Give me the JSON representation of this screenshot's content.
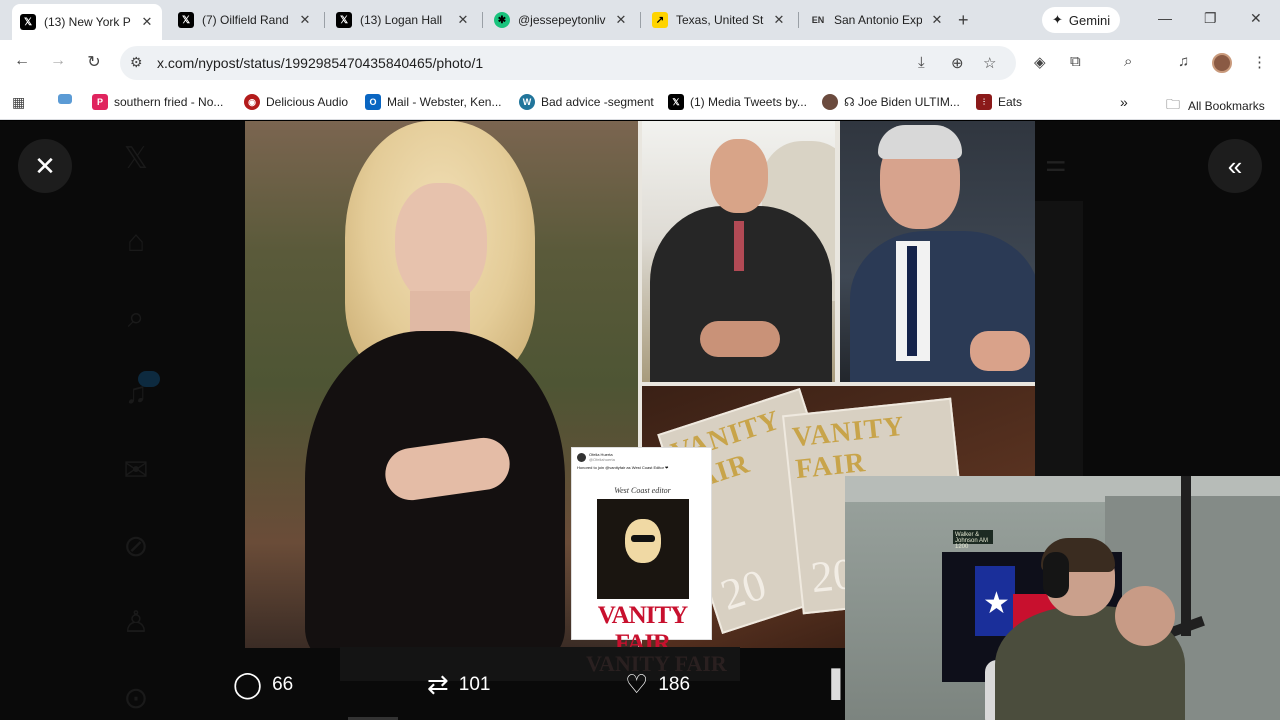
{
  "browser": {
    "tabs": [
      {
        "title": "(13) New York P",
        "favicon": "X",
        "active": true
      },
      {
        "title": "(7) Oilfield Rand",
        "favicon": "X",
        "active": false
      },
      {
        "title": "(13) Logan Hall",
        "favicon": "X",
        "active": false
      },
      {
        "title": "@jessepeytonliv",
        "favicon": "green",
        "active": false
      },
      {
        "title": "Texas, United St",
        "favicon": "yellow",
        "active": false
      },
      {
        "title": "San Antonio Exp",
        "favicon": "EN",
        "active": false
      }
    ],
    "new_tab": "+",
    "gemini_label": "Gemini",
    "url": "x.com/nypost/status/1992985470435840465/photo/1",
    "bookmarks": [
      {
        "label": "southern fried - No...",
        "icon_color": "#e0245e"
      },
      {
        "label": "Delicious Audio",
        "icon_color": "#b31b1b"
      },
      {
        "label": "Mail - Webster, Ken...",
        "icon_color": "#0a66c2"
      },
      {
        "label": "Bad advice -segment",
        "icon_color": "#21759b"
      },
      {
        "label": "(1) Media Tweets by...",
        "icon_color": "#000000"
      },
      {
        "label": "☊ Joe Biden ULTIM...",
        "icon_color": "#6b4b3e"
      },
      {
        "label": "Eats",
        "icon_color": "#8b1a1a"
      }
    ],
    "bookmarks_overflow": "»",
    "all_bookmarks": "All Bookmarks"
  },
  "viewer": {
    "tweet_card": {
      "name": "Ofelia Huerta",
      "handle": "@Ofeliahuerta",
      "text": "Honored to join @vanityfair as West Coast Editor ❤",
      "editor_line": "West Coast editor",
      "logo": "VANITY FAIR"
    },
    "magazine_title": "VANITY FAIR",
    "magazine_year": "20",
    "ghost_caption": "VANITY FAIR",
    "actions": {
      "replies": "66",
      "reposts": "101",
      "likes": "186"
    }
  },
  "webcam": {
    "tv_label": "Walker & Johnson AM 1200"
  }
}
